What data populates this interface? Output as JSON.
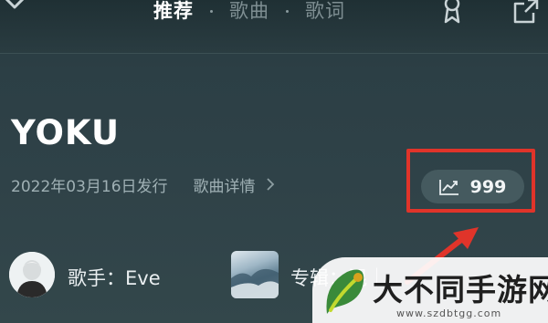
{
  "header": {
    "tabs": [
      {
        "label": "推荐",
        "active": true
      },
      {
        "label": "歌曲",
        "active": false
      },
      {
        "label": "歌词",
        "active": false
      }
    ],
    "icons": [
      "chevron-down-icon",
      "award-ribbon-icon",
      "share-icon"
    ]
  },
  "song": {
    "title": "YOKU",
    "release_text": "2022年03月16日发行",
    "detail_link": "歌曲详情"
  },
  "stats": {
    "hot_count": "999",
    "icon": "trend-chart-icon"
  },
  "artist": {
    "label": "歌手：Eve"
  },
  "album": {
    "label": "专辑：混｜"
  },
  "watermark": {
    "text": "大不同手游网",
    "url": "www.szdbtgg.com"
  },
  "colors": {
    "background": "#2f4248",
    "highlight": "#e0342a",
    "pill": "#455a5f"
  }
}
